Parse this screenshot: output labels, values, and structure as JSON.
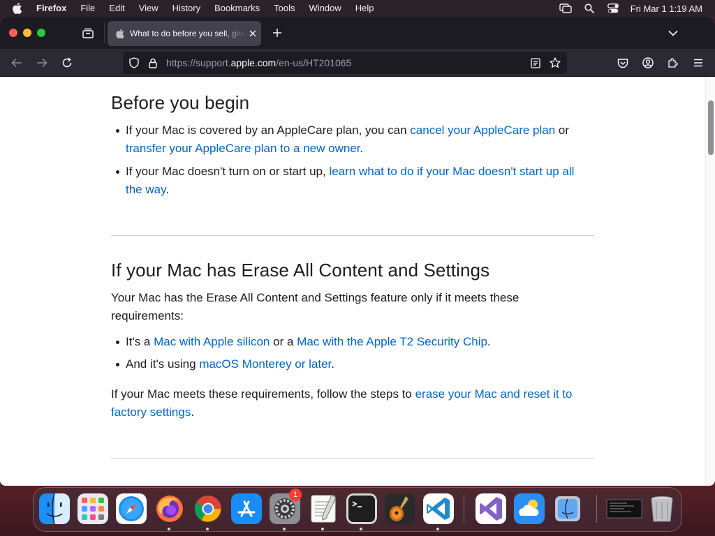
{
  "menubar": {
    "app_name": "Firefox",
    "items": [
      "File",
      "Edit",
      "View",
      "History",
      "Bookmarks",
      "Tools",
      "Window",
      "Help"
    ],
    "clock": "Fri Mar 1  1:19 AM"
  },
  "browser": {
    "tab_title": "What to do before you sell, give away, or trade in your Mac",
    "url_prefix": "https://support.",
    "url_host": "apple.com",
    "url_path": "/en-us/HT201065"
  },
  "article": {
    "section1": {
      "heading": "Before you begin",
      "bullet1": {
        "text1": "If your Mac is covered by an AppleCare plan, you can ",
        "link1": "cancel your AppleCare plan",
        "text2": " or ",
        "link2": "transfer your AppleCare plan to a new owner",
        "text3": "."
      },
      "bullet2": {
        "text1": "If your Mac doesn't turn on or start up, ",
        "link1": "learn what to do if your Mac doesn't start up all the way",
        "text2": "."
      }
    },
    "section2": {
      "heading": "If your Mac has Erase All Content and Settings",
      "intro": "Your Mac has the Erase All Content and Settings feature only if it meets these requirements:",
      "bullet1": {
        "text1": "It's a ",
        "link1": "Mac with Apple silicon",
        "text2": " or a ",
        "link2": "Mac with the Apple T2 Security Chip",
        "text3": "."
      },
      "bullet2": {
        "text1": "And it's using ",
        "link1": "macOS Monterey or later",
        "text2": "."
      },
      "outro": {
        "text1": "If your Mac meets these requirements, follow the steps to ",
        "link1": "erase your Mac and reset it to factory settings",
        "text2": "."
      }
    }
  },
  "dock": {
    "apps": [
      "finder-icon",
      "launchpad-icon",
      "safari-icon",
      "firefox-icon",
      "chrome-icon",
      "app-store-icon",
      "system-settings-icon",
      "textedit-icon",
      "terminal-icon",
      "garageband-icon",
      "vscode-icon",
      "visual-studio-icon",
      "weather-icon",
      "migration-assistant-icon",
      "screen-recording-icon",
      "trash-icon"
    ],
    "settings_badge": "1"
  },
  "colors": {
    "link": "#0066cc",
    "text": "#1d1d1f",
    "toolbar": "#2b2a33",
    "tabbar": "#1c1b22"
  }
}
